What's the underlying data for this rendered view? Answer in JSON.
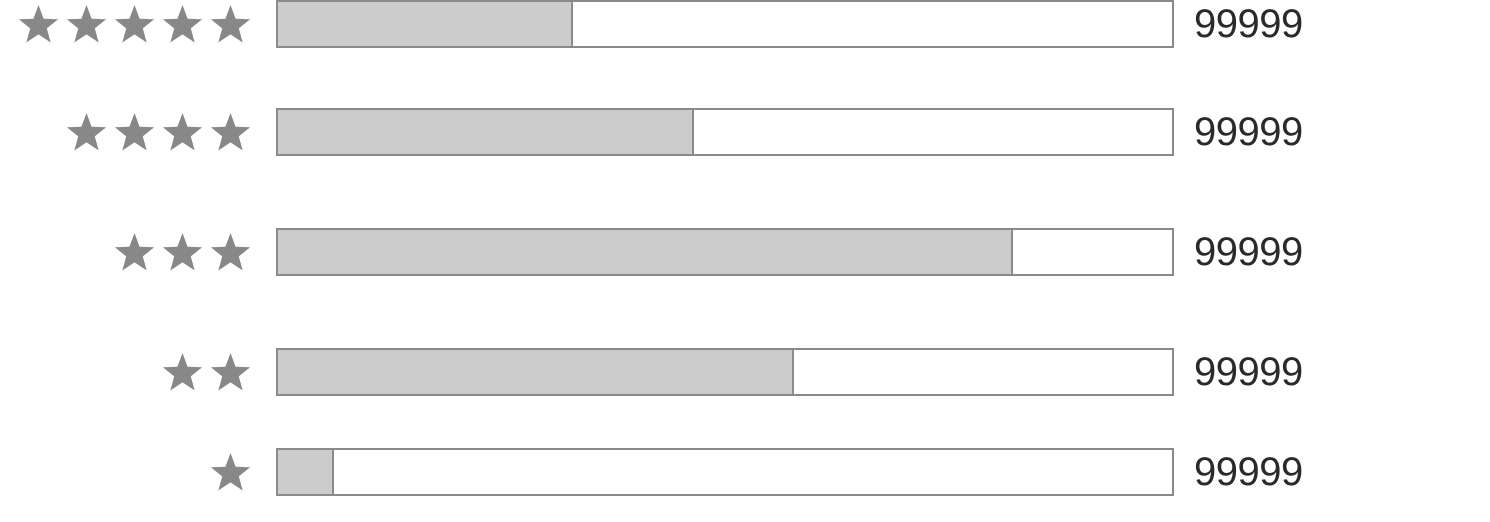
{
  "colors": {
    "star": "#888888",
    "bar_border": "#8a8a8a",
    "bar_fill": "#cccccc",
    "bar_background": "#ffffff",
    "count_text": "#2a2a2a"
  },
  "icons": {
    "star": "star-icon"
  },
  "ratings": [
    {
      "stars": 5,
      "fill_fraction": 0.33,
      "count": "99999"
    },
    {
      "stars": 4,
      "fill_fraction": 0.465,
      "count": "99999"
    },
    {
      "stars": 3,
      "fill_fraction": 0.822,
      "count": "99999"
    },
    {
      "stars": 2,
      "fill_fraction": 0.577,
      "count": "99999"
    },
    {
      "stars": 1,
      "fill_fraction": 0.063,
      "count": "99999"
    }
  ]
}
